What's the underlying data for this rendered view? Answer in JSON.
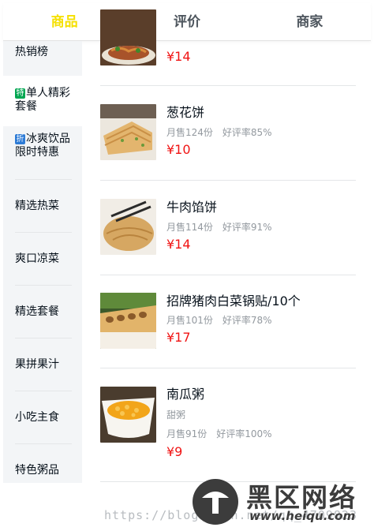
{
  "tabs": [
    {
      "label": "商品",
      "active": true
    },
    {
      "label": "评价",
      "active": false
    },
    {
      "label": "商家",
      "active": false
    }
  ],
  "menu": {
    "items": [
      {
        "label": "热销榜"
      },
      {
        "badge": "特",
        "badge_color": "#00a651",
        "label": "单人精彩套餐"
      },
      {
        "badge": "折",
        "badge_color": "#2d7bd6",
        "label": "冰爽饮品限时特惠"
      },
      {
        "label": "精选热菜"
      },
      {
        "label": "爽口凉菜"
      },
      {
        "label": "精选套餐"
      },
      {
        "label": "果拼果汁"
      },
      {
        "label": "小吃主食"
      },
      {
        "label": "特色粥品"
      }
    ]
  },
  "foods": [
    {
      "name": "",
      "price": "¥14"
    },
    {
      "name": "葱花饼",
      "sales": "月售124份",
      "rating": "好评率85%",
      "price": "¥10"
    },
    {
      "name": "牛肉馅饼",
      "sales": "月售114份",
      "rating": "好评率91%",
      "price": "¥14"
    },
    {
      "name": "招牌猪肉白菜锅贴/10个",
      "sales": "月售101份",
      "rating": "好评率78%",
      "price": "¥17"
    },
    {
      "name": "南瓜粥",
      "description": "甜粥",
      "sales": "月售91份",
      "rating": "好评率100%",
      "price": "¥9"
    }
  ],
  "watermark": {
    "url": "https://blog.csdn.net/qq_4709823",
    "site_name": "黑区网络",
    "site_url": "www.heiqu.com"
  },
  "colors": {
    "active_tab": "#f5e000",
    "price": "#f01414",
    "menu_bg": "#f3f5f7"
  }
}
